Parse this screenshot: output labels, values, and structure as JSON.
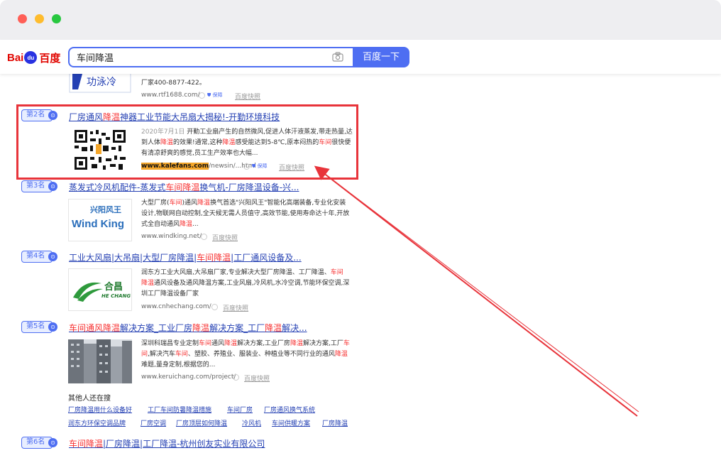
{
  "search": {
    "query": "车间降温",
    "button_label": "百度一下"
  },
  "logo": {
    "bai": "Bai",
    "du": "du",
    "cn": "百度"
  },
  "top_partial": {
    "line1": "厂家400-8877-422。",
    "url": "www.rtf1688.com/",
    "kuaizhao": "百度快照",
    "baozhang": "保障"
  },
  "results": [
    {
      "rank": "第2名",
      "title_parts": [
        "厂房通风",
        "降温",
        "神器工业节能大吊扇大揭秘!-开勤环境科技"
      ],
      "date": "2020年7月1日",
      "snippet_parts": [
        " 开勤工业扇产生的自然微风,促进人体汗液蒸发,带走热量,达到人体",
        "降温",
        "的效果!通常,这种",
        "降温",
        "感受能达到5-8℃,原本闷热的",
        "车间",
        "很快便有清凉舒爽的感觉,员工生产效率也大幅..."
      ],
      "url_hl": "www.kalefans.com",
      "url_rest": "/newsin/...html",
      "baozhang": "保障",
      "kuaizhao": "百度快照"
    },
    {
      "rank": "第3名",
      "title_parts": [
        "蒸发式冷风机配件-蒸发式",
        "车间降温",
        "换气机-厂房降温设备-兴..."
      ],
      "snippet_parts": [
        "大型厂房(",
        "车间",
        ")通风",
        "降温",
        "换气首选\"兴阳风王\"智能化高端装备,专业化安装设计,物联网自动控制,全天候无需人员值守,高效节能,使用寿命达十年,开放式全自动通风",
        "降温",
        "..."
      ],
      "logo_top": "兴阳风王",
      "logo_bottom": "Wind King",
      "url": "www.windking.net/",
      "kuaizhao": "百度快照"
    },
    {
      "rank": "第4名",
      "title_parts": [
        "工业大风扇|大吊扇|大型厂房降温|",
        "车间降温",
        "|工厂通风设备及..."
      ],
      "snippet_parts": [
        "润东方工业大风扇,大吊扇厂家,专业解决大型厂房降温、工厂降温、",
        "车间",
        "\n",
        "降温",
        "通风设备及通风降温方案,工业风扇,冷风机,水冷空调,节能环保空调,深圳工厂降温设备厂家"
      ],
      "logo_top": "合昌",
      "logo_bottom": "HE CHANG",
      "url": "www.cnhechang.com/",
      "kuaizhao": "百度快照"
    },
    {
      "rank": "第5名",
      "title_parts": [
        "车间通风",
        "降温",
        "解决方案_工业厂房",
        "降温",
        "解决方案_工厂",
        "降温",
        "解决..."
      ],
      "snippet_parts": [
        "深圳科瑞昌专业定制",
        "车间",
        "通风",
        "降温",
        "解决方案,工业厂房",
        "降温",
        "解决方案,工厂",
        "车间",
        ",解决汽车",
        "车间",
        "、塑胶、养殖业、服装业、种植业等不同行业的通风",
        "降温",
        "难题,量身定制,根据您的..."
      ],
      "url": "www.keruichang.com/project/",
      "kuaizhao": "百度快照"
    }
  ],
  "related": {
    "title": "其他人还在搜",
    "row1": [
      "厂房降温用什么设备好",
      "工厂车间防暑降温措施",
      "车间厂房",
      "厂房通风换气系统"
    ],
    "row2": [
      "润东方环保空调品牌",
      "厂房空调",
      "厂房顶层如何降温",
      "冷风机",
      "车间供暖方案",
      "厂房降温"
    ]
  },
  "result6": {
    "rank": "第6名",
    "title_parts": [
      "车间降温",
      "|厂房降温|工厂降温-杭州创友实业有限公司"
    ]
  },
  "colors": {
    "accent": "#4e6ef2",
    "highlight": "#f73131",
    "box": "#e8343b",
    "link": "#2440b3"
  }
}
